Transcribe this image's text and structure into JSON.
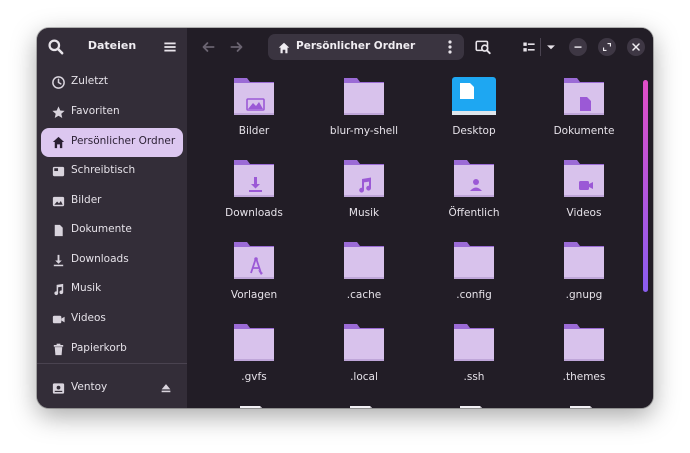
{
  "sidebar": {
    "title": "Dateien",
    "places": [
      {
        "label": "Zuletzt",
        "icon": "clock-icon",
        "active": false
      },
      {
        "label": "Favoriten",
        "icon": "star-icon",
        "active": false
      },
      {
        "label": "Persönlicher Ordner",
        "icon": "home-icon",
        "active": true
      },
      {
        "label": "Schreibtisch",
        "icon": "desktop-icon",
        "active": false
      },
      {
        "label": "Bilder",
        "icon": "image-icon",
        "active": false
      },
      {
        "label": "Dokumente",
        "icon": "document-icon",
        "active": false
      },
      {
        "label": "Downloads",
        "icon": "download-icon",
        "active": false
      },
      {
        "label": "Musik",
        "icon": "music-icon",
        "active": false
      },
      {
        "label": "Videos",
        "icon": "video-icon",
        "active": false
      },
      {
        "label": "Papierkorb",
        "icon": "trash-icon",
        "active": false
      }
    ],
    "devices": [
      {
        "label": "Ventoy",
        "icon": "drive-icon"
      }
    ]
  },
  "header": {
    "path_label": "Persönlicher Ordner"
  },
  "files": [
    {
      "name": "Bilder",
      "emblem": "image"
    },
    {
      "name": "blur-my-shell",
      "emblem": "none"
    },
    {
      "name": "Desktop",
      "emblem": "desktop"
    },
    {
      "name": "Dokumente",
      "emblem": "document"
    },
    {
      "name": "Downloads",
      "emblem": "download"
    },
    {
      "name": "Musik",
      "emblem": "music"
    },
    {
      "name": "Öffentlich",
      "emblem": "user"
    },
    {
      "name": "Videos",
      "emblem": "video"
    },
    {
      "name": "Vorlagen",
      "emblem": "template"
    },
    {
      "name": ".cache",
      "emblem": "none"
    },
    {
      "name": ".config",
      "emblem": "none"
    },
    {
      "name": ".gnupg",
      "emblem": "none"
    },
    {
      "name": ".gvfs",
      "emblem": "none"
    },
    {
      "name": ".local",
      "emblem": "none"
    },
    {
      "name": ".ssh",
      "emblem": "none"
    },
    {
      "name": ".themes",
      "emblem": "none"
    }
  ],
  "colors": {
    "folder": "#d8c2ec",
    "folder_tab": "#9b6bd6",
    "emblem": "#9b59d6",
    "desktop_blue": "#1ea7f2",
    "accent_active": "#dcc7f0"
  }
}
